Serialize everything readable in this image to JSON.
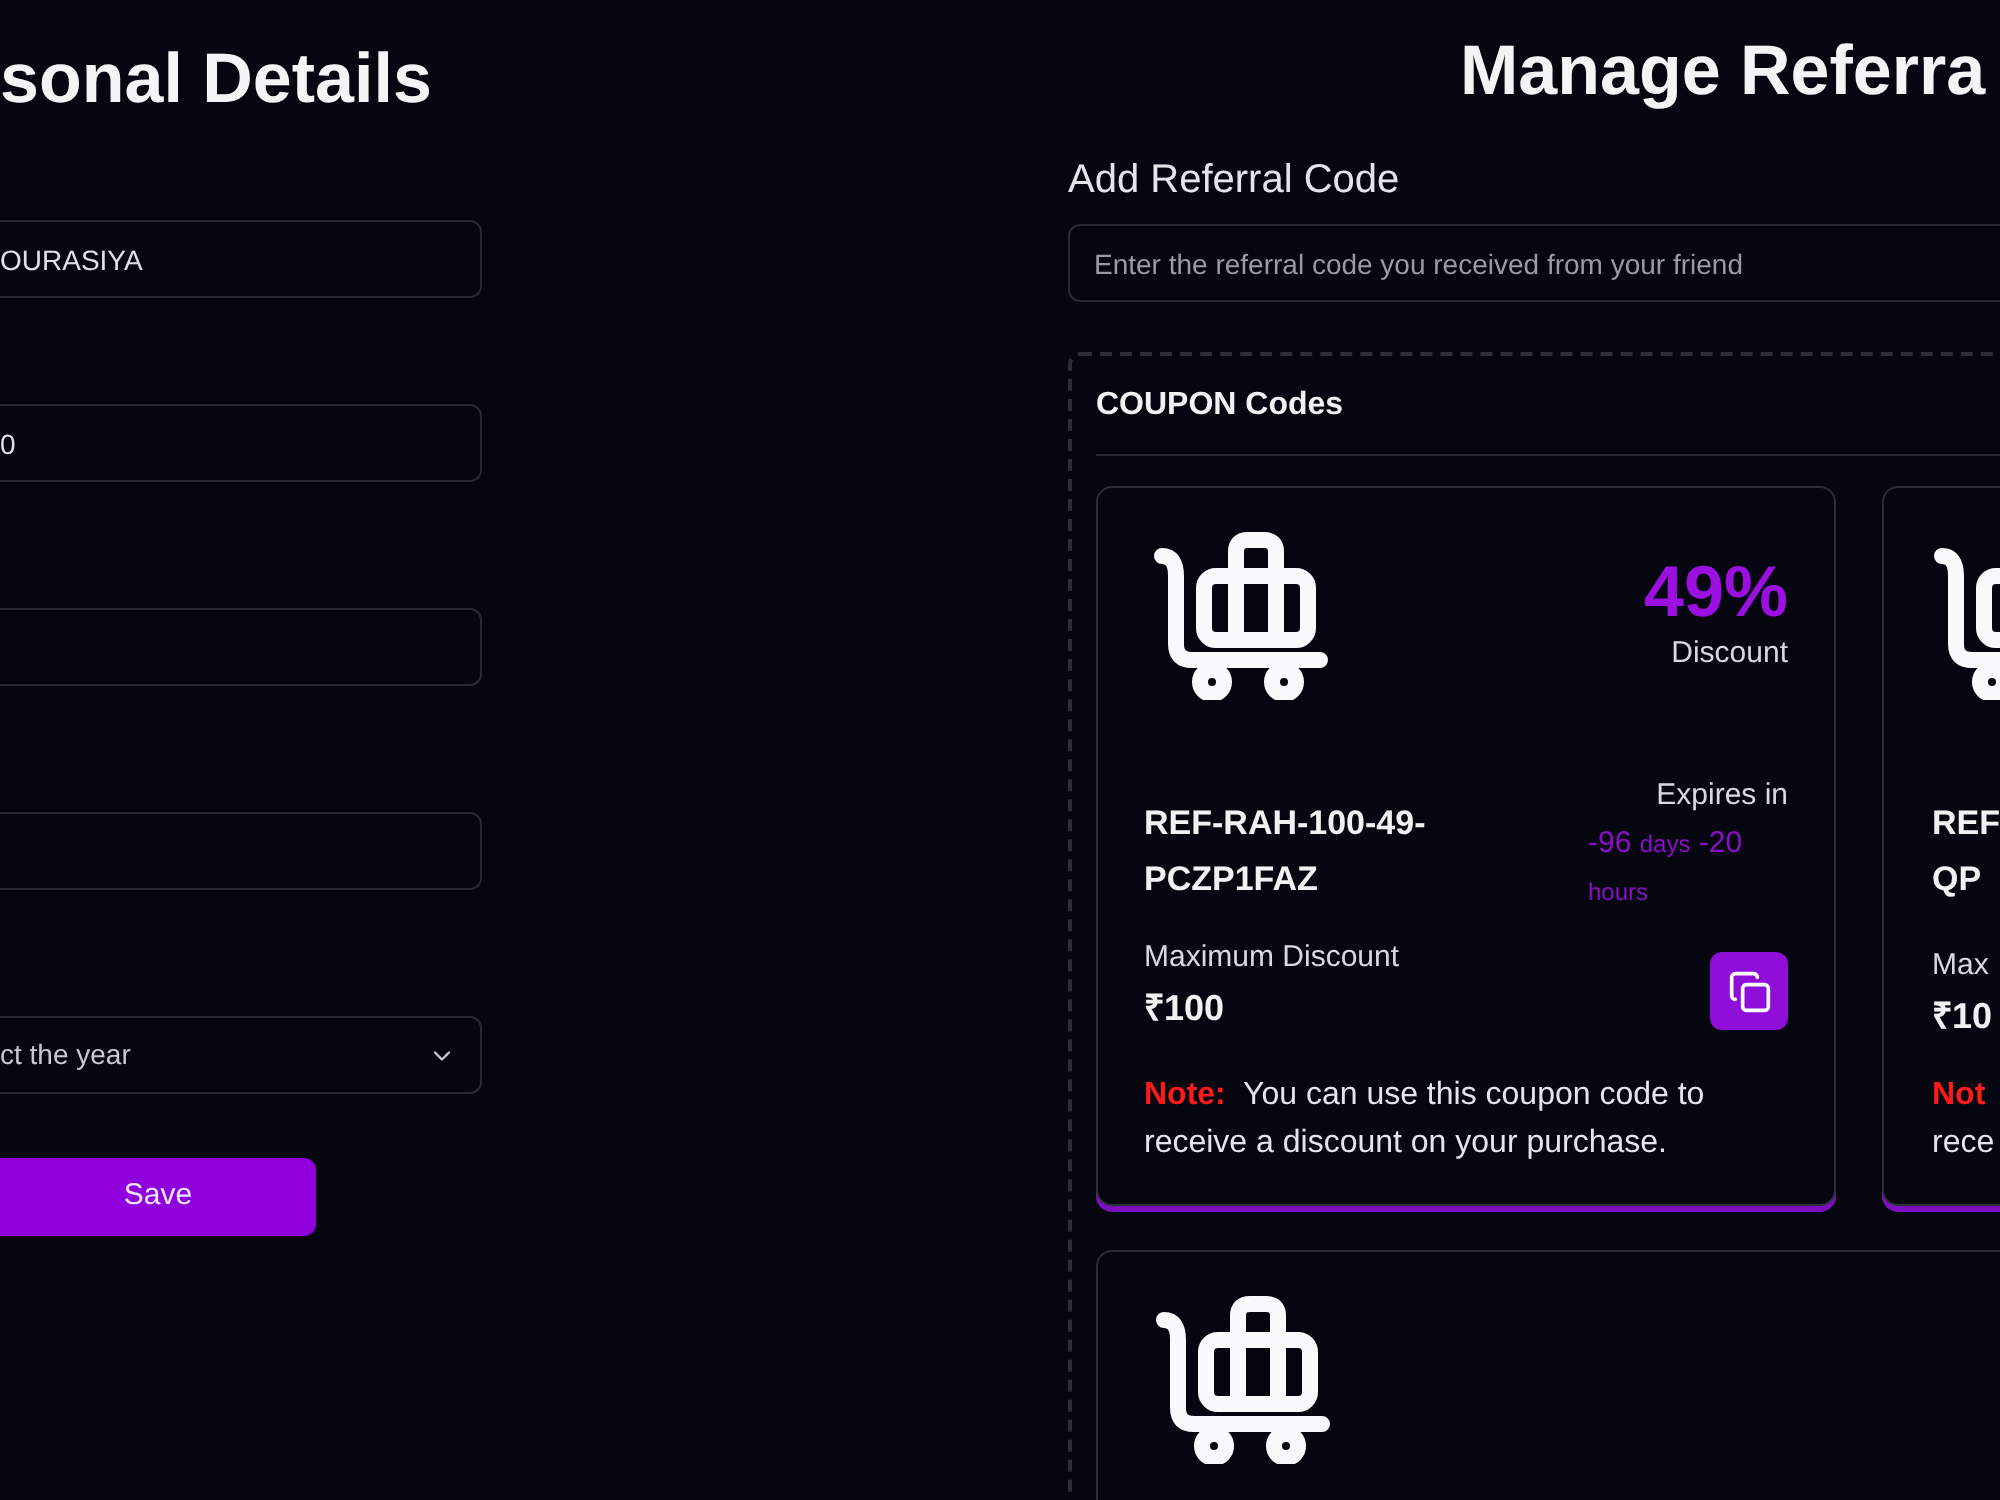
{
  "personal": {
    "title": "sonal Details",
    "fields": [
      {
        "kind": "text",
        "value": "OURASIYA"
      },
      {
        "kind": "text",
        "value": "0"
      },
      {
        "kind": "text"
      },
      {
        "kind": "text"
      },
      {
        "kind": "select",
        "placeholder": "ct the year"
      }
    ],
    "save_button": "Save"
  },
  "referrals": {
    "title": "Manage Referra",
    "add_label": "Add Referral Code",
    "add_placeholder": "Enter the referral code you received from your friend",
    "coupons_title": "COUPON Codes",
    "coupons": [
      {
        "kind": "full",
        "percent": "49%",
        "discount_label": "Discount",
        "code_lines": [
          "REF-RAH-100-49-",
          "PCZP1FAZ"
        ],
        "expires_label": "Expires in",
        "days_num": "-96",
        "days_unit": "days",
        "hours_num": "-20",
        "hours_unit": "hours",
        "max_label": "Maximum Discount",
        "max_value": "₹100",
        "note_label": "Note:",
        "note_text": "You can use this coupon code to receive a discount on your purchase."
      },
      {
        "kind": "cut",
        "code_lines": [
          "REF",
          "QP"
        ],
        "max_label": "Max",
        "max_value": "₹10",
        "note_label": "Not",
        "note_text": "rece"
      },
      {
        "kind": "icon_only"
      }
    ]
  }
}
